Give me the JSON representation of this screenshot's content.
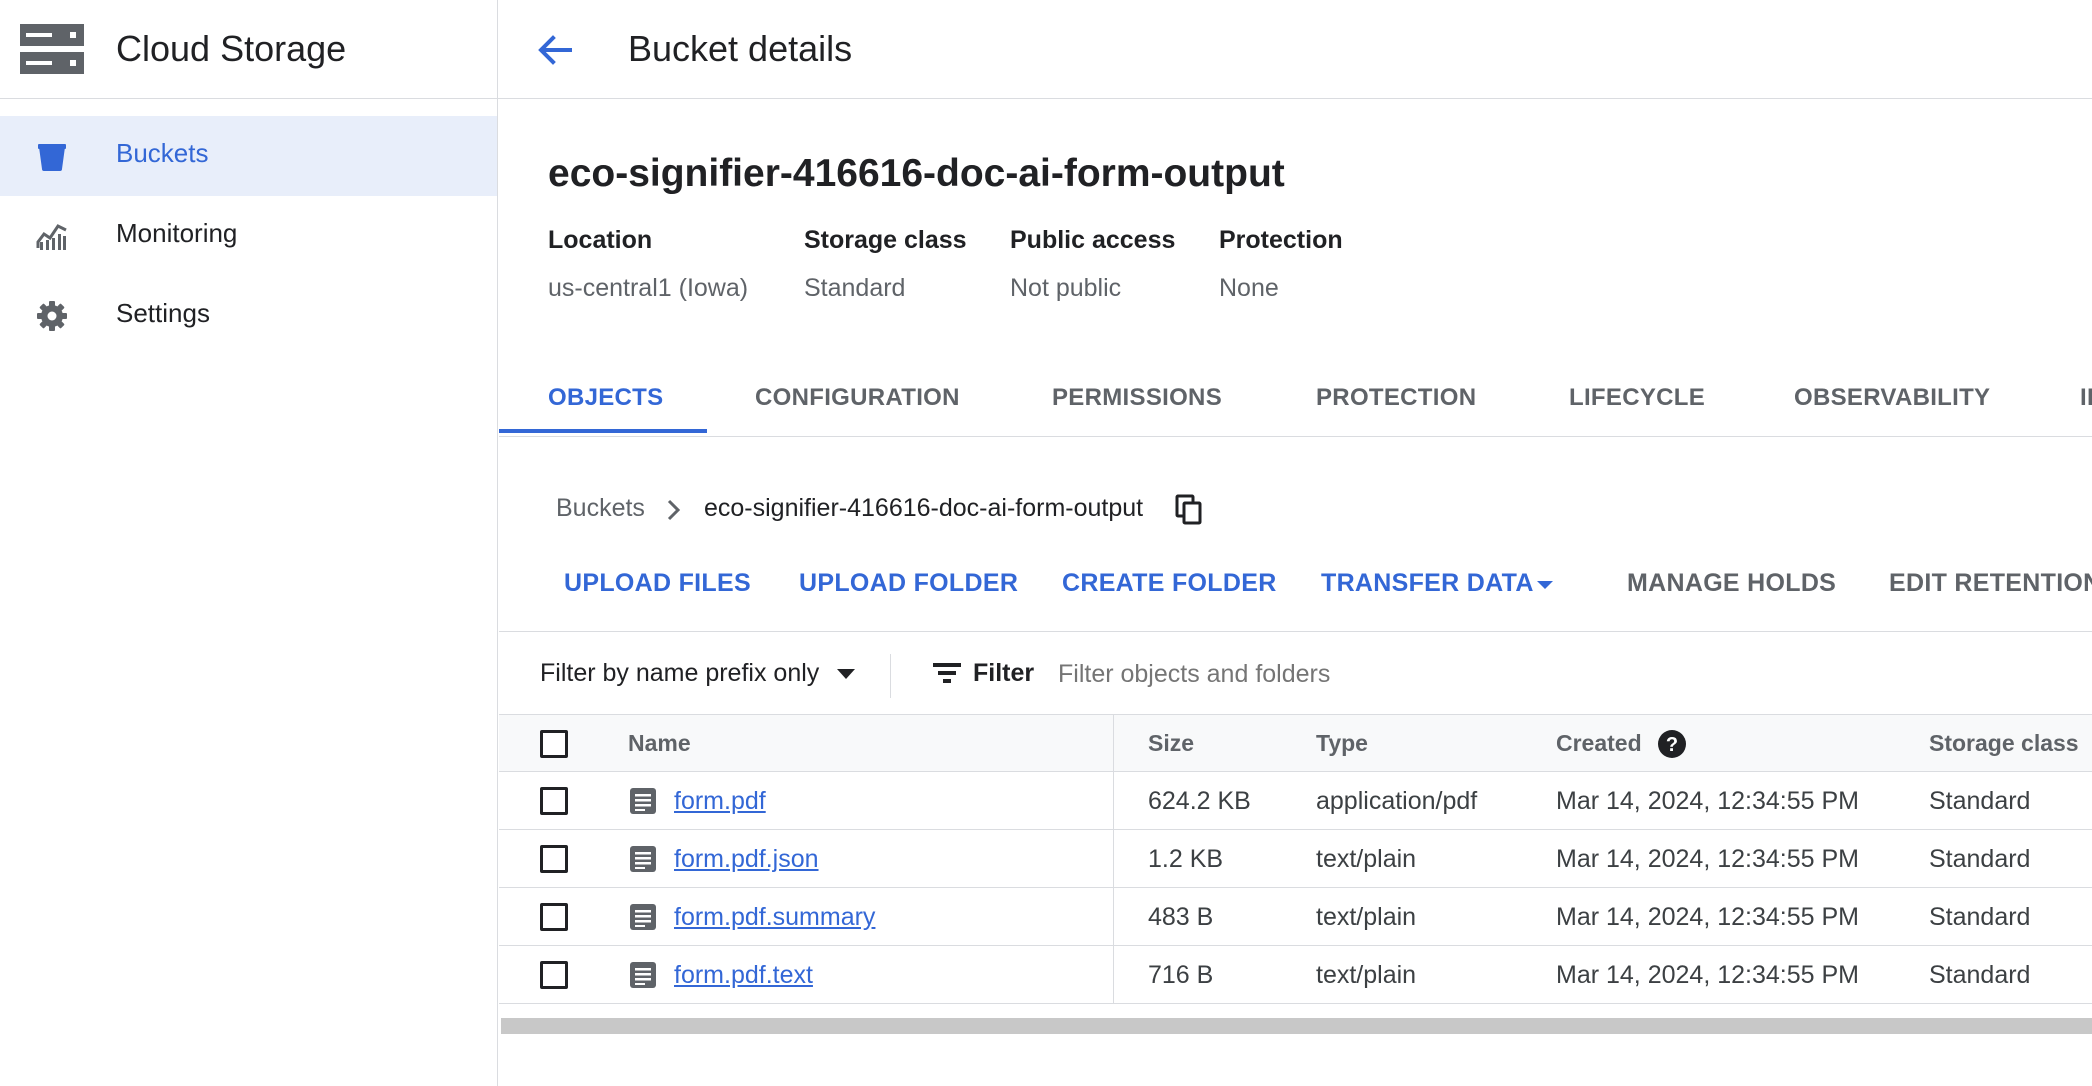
{
  "app": {
    "title": "Cloud Storage"
  },
  "sidebar": {
    "items": [
      {
        "label": "Buckets",
        "icon": "bucket-icon",
        "active": true
      },
      {
        "label": "Monitoring",
        "icon": "monitoring-icon",
        "active": false
      },
      {
        "label": "Settings",
        "icon": "gear-icon",
        "active": false
      }
    ]
  },
  "header": {
    "title": "Bucket details",
    "back_icon": "arrow-back-icon"
  },
  "bucket": {
    "name": "eco-signifier-416616-doc-ai-form-output",
    "meta": [
      {
        "label": "Location",
        "value": "us-central1 (Iowa)"
      },
      {
        "label": "Storage class",
        "value": "Standard"
      },
      {
        "label": "Public access",
        "value": "Not public"
      },
      {
        "label": "Protection",
        "value": "None"
      }
    ]
  },
  "tabs": [
    {
      "label": "OBJECTS",
      "active": true
    },
    {
      "label": "CONFIGURATION"
    },
    {
      "label": "PERMISSIONS"
    },
    {
      "label": "PROTECTION"
    },
    {
      "label": "LIFECYCLE"
    },
    {
      "label": "OBSERVABILITY"
    },
    {
      "label": "II"
    }
  ],
  "breadcrumb": {
    "root": "Buckets",
    "current": "eco-signifier-416616-doc-ai-form-output",
    "copy_icon": "copy-icon"
  },
  "actions": {
    "upload_files": "UPLOAD FILES",
    "upload_folder": "UPLOAD FOLDER",
    "create_folder": "CREATE FOLDER",
    "transfer_data": "TRANSFER DATA",
    "manage_holds": "MANAGE HOLDS",
    "edit_retention": "EDIT RETENTION"
  },
  "filter": {
    "mode": "Filter by name prefix only",
    "label": "Filter",
    "placeholder": "Filter objects and folders"
  },
  "table": {
    "columns": {
      "name": "Name",
      "size": "Size",
      "type": "Type",
      "created": "Created",
      "storage_class": "Storage class"
    },
    "rows": [
      {
        "name": "form.pdf",
        "size": "624.2 KB",
        "type": "application/pdf",
        "created": "Mar 14, 2024, 12:34:55 PM",
        "storage_class": "Standard"
      },
      {
        "name": "form.pdf.json",
        "size": "1.2 KB",
        "type": "text/plain",
        "created": "Mar 14, 2024, 12:34:55 PM",
        "storage_class": "Standard"
      },
      {
        "name": "form.pdf.summary",
        "size": "483 B",
        "type": "text/plain",
        "created": "Mar 14, 2024, 12:34:55 PM",
        "storage_class": "Standard"
      },
      {
        "name": "form.pdf.text",
        "size": "716 B",
        "type": "text/plain",
        "created": "Mar 14, 2024, 12:34:55 PM",
        "storage_class": "Standard"
      }
    ]
  },
  "colors": {
    "accent": "#3367d6",
    "active_bg": "#e8eefa",
    "text": "#202124",
    "muted": "#5f6368",
    "border": "#dadce0"
  }
}
